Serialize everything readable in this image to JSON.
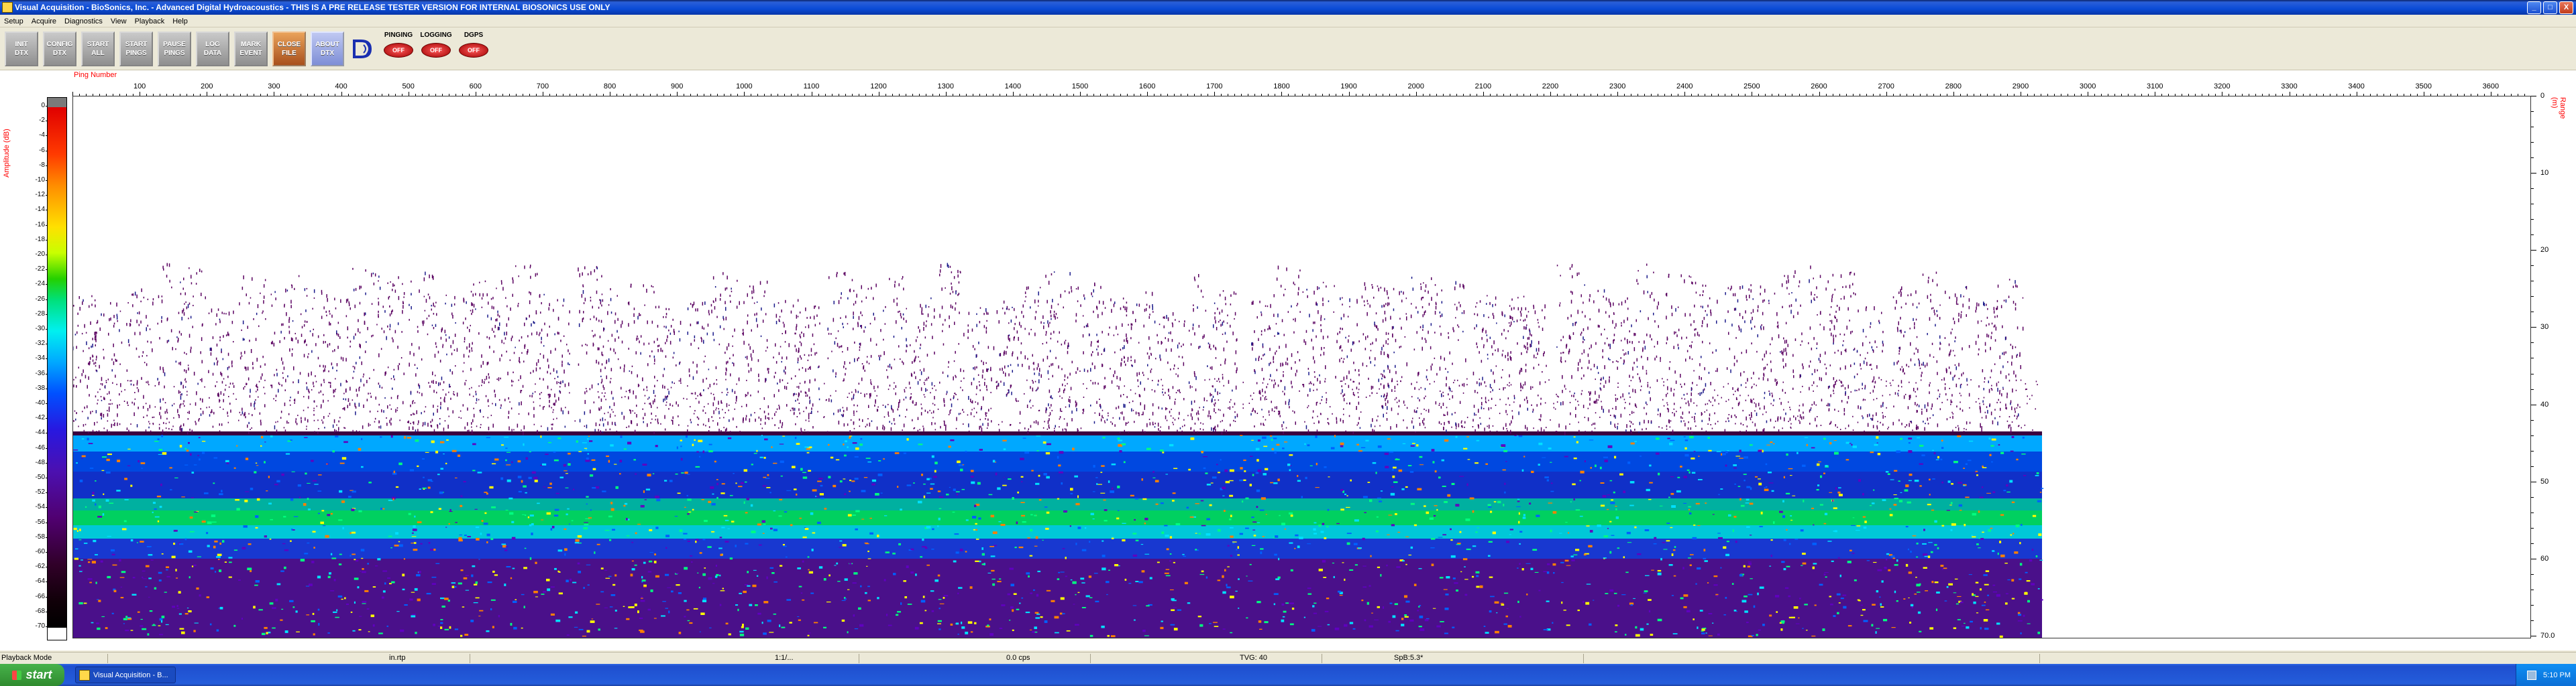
{
  "window": {
    "title": "Visual Acquisition  -  BioSonics, Inc.  -  Advanced Digital Hydroacoustics  -  THIS IS A PRE RELEASE TESTER VERSION FOR INTERNAL BIOSONICS USE ONLY",
    "minimize": "_",
    "maximize": "□",
    "close": "X"
  },
  "menu": [
    "Setup",
    "Acquire",
    "Diagnostics",
    "View",
    "Playback",
    "Help"
  ],
  "toolbar": {
    "buttons": [
      {
        "label": "INIT\nDTX",
        "style": "gray"
      },
      {
        "label": "CONFIG\nDTX",
        "style": "gray"
      },
      {
        "label": "START\nALL",
        "style": "gray"
      },
      {
        "label": "START\nPINGS",
        "style": "gray"
      },
      {
        "label": "PAUSE\nPINGS",
        "style": "gray"
      },
      {
        "label": "LOG\nDATA",
        "style": "gray"
      },
      {
        "label": "MARK\nEVENT",
        "style": "gray"
      },
      {
        "label": "CLOSE\nFILE",
        "style": "orange"
      },
      {
        "label": "ABOUT\nDTX",
        "style": "blue"
      }
    ],
    "logo_icon": "biosonics-logo-icon",
    "indicators": [
      {
        "title": "PINGING",
        "state": "OFF"
      },
      {
        "title": "LOGGING",
        "state": "OFF"
      },
      {
        "title": "DGPS",
        "state": "OFF"
      }
    ]
  },
  "plot": {
    "ping_axis_label": "Ping Number",
    "amplitude_axis_label": "Amplitude (dB)",
    "range_axis_label": "Range (m)",
    "ping_ticks": [
      "100",
      "200",
      "300",
      "400",
      "500",
      "600",
      "700",
      "800",
      "900",
      "1000",
      "1100",
      "1200",
      "1300",
      "1400",
      "1500",
      "1600",
      "1700",
      "1800",
      "1900",
      "2000",
      "2100",
      "2200",
      "2300",
      "2400",
      "2500",
      "2600",
      "2700",
      "2800",
      "2900",
      "3000",
      "3100",
      "3200",
      "3300",
      "3400",
      "3500",
      "3600"
    ],
    "colorbar_ticks": [
      "0",
      "-2",
      "-4",
      "-6",
      "-8",
      "-10",
      "-12",
      "-14",
      "-16",
      "-18",
      "-20",
      "-22",
      "-24",
      "-26",
      "-28",
      "-30",
      "-32",
      "-34",
      "-36",
      "-38",
      "-40",
      "-42",
      "-44",
      "-46",
      "-48",
      "-50",
      "-52",
      "-54",
      "-56",
      "-58",
      "-60",
      "-62",
      "-64",
      "-66",
      "-68",
      "-70"
    ],
    "range_ticks": [
      "0",
      "10",
      "20",
      "30",
      "40",
      "50",
      "60",
      "70.0"
    ],
    "colors": {
      "axis_label": "#ff0000",
      "echo_strong": "#00d060",
      "echo_mid": "#0070ff",
      "echo_weak": "#3a00a0",
      "noise": "#5a0060"
    }
  },
  "statusbar": {
    "mode": "Playback Mode",
    "file": "in.rtp",
    "position": "1:1/...",
    "rate": "0.0 cps",
    "tvg": "TVG: 40",
    "spb": "SpB:5.3*"
  },
  "taskbar": {
    "start_label": "start",
    "task_label": "Visual Acquisition - B...",
    "clock": "5:10 PM"
  }
}
